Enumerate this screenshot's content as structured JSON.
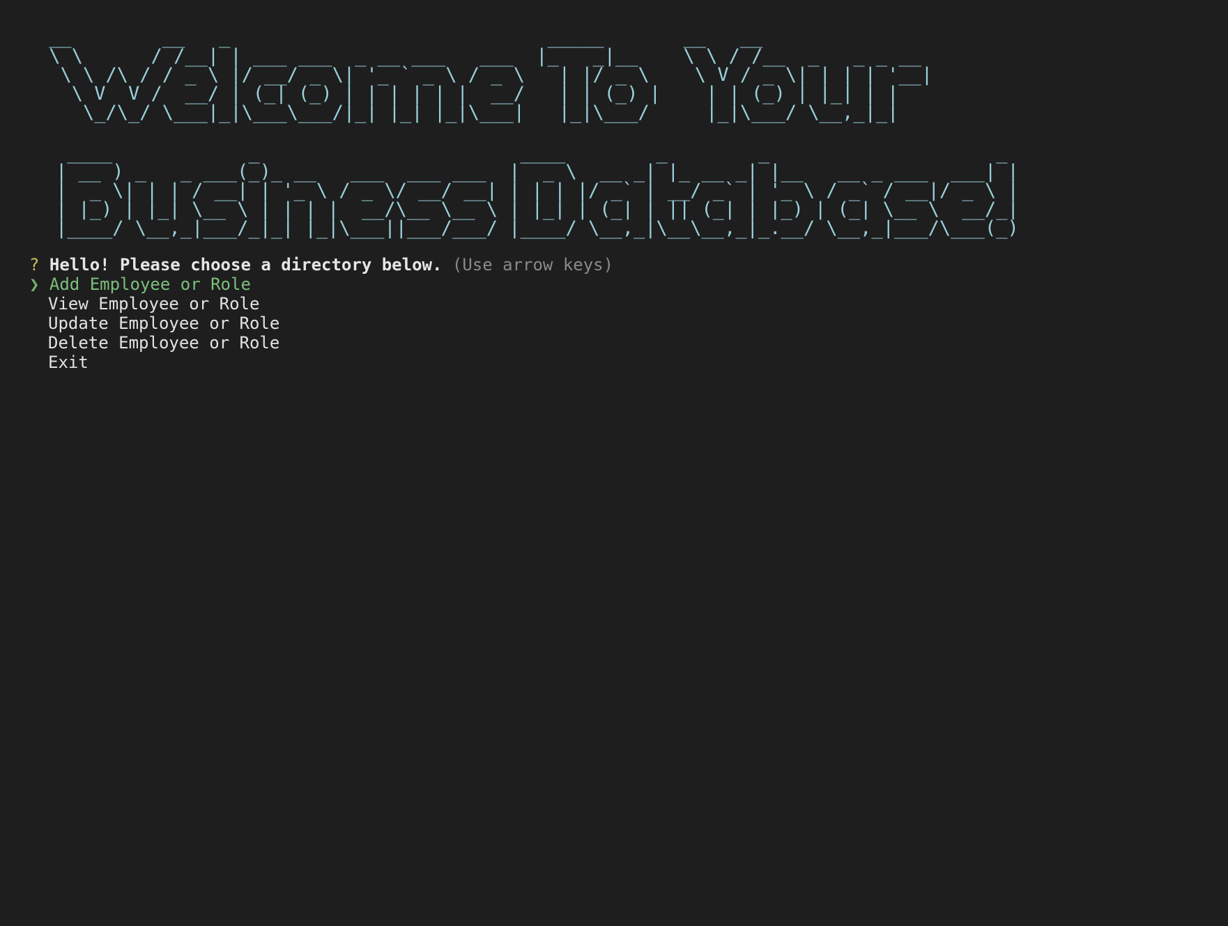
{
  "banner": {
    "line1": "Welcome To Your",
    "line2": "Business Database!"
  },
  "prompt": {
    "qmark": "?",
    "question": "Hello! Please choose a directory below.",
    "hint": "(Use arrow keys)",
    "pointer": "❯",
    "choices": [
      "Add Employee or Role",
      "View Employee or Role",
      "Update Employee or Role",
      "Delete Employee or Role",
      "Exit"
    ],
    "selected_index": 0
  },
  "colors": {
    "background": "#1e1e1e",
    "banner": "#9ad0dc",
    "question_mark": "#c8c35a",
    "selected": "#7cbf7c",
    "hint": "#8a8a8a",
    "text": "#e2e2e2"
  }
}
